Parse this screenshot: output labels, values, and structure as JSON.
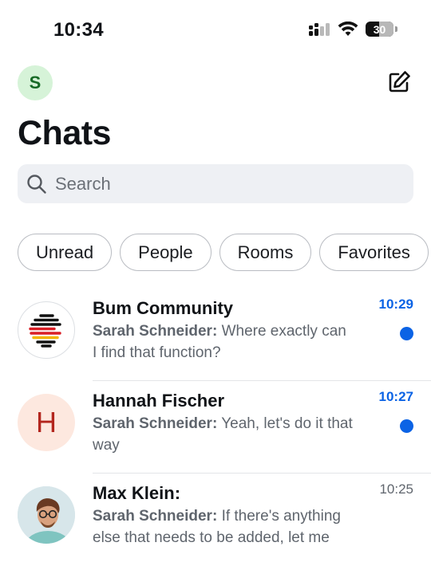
{
  "status_bar": {
    "time": "10:34",
    "battery": "30"
  },
  "header": {
    "avatar_initial": "S",
    "title": "Chats"
  },
  "search": {
    "placeholder": "Search"
  },
  "filters": [
    "Unread",
    "People",
    "Rooms",
    "Favorites"
  ],
  "chats": [
    {
      "name": "Bum Community",
      "sender": "Sarah Schneider:",
      "message": "Where exactly can I find that function?",
      "time": "10:29",
      "unread": true
    },
    {
      "name": "Hannah Fischer",
      "avatar_initial": "H",
      "sender": "Sarah Schneider:",
      "message": "Yeah, let's do it that way",
      "time": "10:27",
      "unread": true
    },
    {
      "name": "Max Klein:",
      "sender": "Sarah Schneider:",
      "message": "If there's anything else that needs to be added, let me",
      "time": "10:25",
      "unread": false
    }
  ],
  "colors": {
    "accent": "#0b63e5",
    "avatar_me_bg": "#d6f3d8",
    "avatar_h_bg": "#fde8df",
    "avatar_h_fg": "#b3261e"
  }
}
